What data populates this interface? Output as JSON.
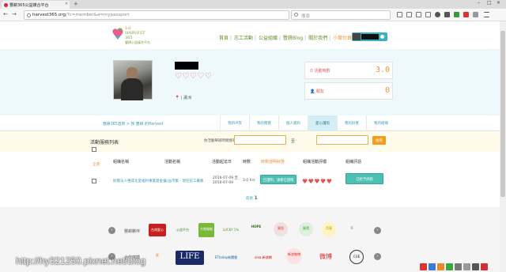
{
  "browser": {
    "tab_title": "豐耕365公益媒合平台",
    "tab_close": "×",
    "new_tab": "+",
    "url_host": "harvest365.org",
    "url_path": "/?c=member&a=mypassport",
    "search_placeholder": "搜尋",
    "back": "←",
    "forward": "→",
    "reload": "C"
  },
  "site": {
    "logo_line1": "1st",
    "logo_line2": "HARVEST",
    "logo_line3": "365",
    "logo_sub": "豐耕公益媒合平台",
    "menu": [
      "首頁",
      "志工活動",
      "公益組織",
      "豐耕Blog",
      "關於我們",
      "小幫忙員"
    ],
    "menu_sep": "|"
  },
  "profile": {
    "hearts": "♡♡♡♡♡",
    "location": "📍  |  蘆洲",
    "stats": [
      {
        "label": "⏱ 活動時數",
        "value": "3.0"
      },
      {
        "label": "👤 關友",
        "value": "0"
      }
    ]
  },
  "breadcrumb": "豐耕365首頁 > 我 豐耕 的Harvest",
  "tabs": [
    "我的IP等",
    "我的簡歷",
    "個人資料",
    "愛心護照",
    "我的財產",
    "我的組織"
  ],
  "active_tab_index": 3,
  "list": {
    "title": "活動服務列表",
    "filter_label": "依活動舉辦時間搜尋",
    "date_to": "至",
    "search_button": "搜尋",
    "select_all": "全選",
    "columns": [
      "組織名稱",
      "活動名稱",
      "活動起迄日",
      "時數",
      "時數證明狀態",
      "組織活動評價",
      "組織評語"
    ],
    "rows": [
      {
        "org": "財團法人惠成化愛福利事業基金會",
        "activity": "公益市集 - 現任志工募集",
        "date": "2016-07-09 至\n2016-07-09",
        "hours": "3.0 hrs",
        "status_button": "已證明，請看已證明",
        "hearts": "♥♥♥♥♥",
        "comment_button": "已給予評語"
      }
    ],
    "pager_prefix": "前頁",
    "pager_current": "1"
  },
  "sponsors": {
    "row1_label": "豐耕夥伴",
    "row2_label": "合作媒體",
    "row1": [
      "台灣愛心",
      "公益平台",
      "大地綠能",
      "LUCKY 1%",
      "HOPE",
      "資訊",
      "圓環",
      "月亮",
      "花",
      "草"
    ],
    "row2": [
      "豐",
      "LIFE",
      "ETtoday新聞雲",
      "sina 新浪網",
      "新浪微博",
      "微博",
      "CUE",
      "創業"
    ],
    "prev": "‹",
    "next": "›"
  },
  "watermark": "http://hy321250.pixnet.net/blog",
  "colors": {
    "accent_green": "#6a8e2a",
    "accent_orange": "#e9953b",
    "teal": "#4dbfb5",
    "band_blue": "#eef9fb",
    "cream": "#fffbea"
  }
}
